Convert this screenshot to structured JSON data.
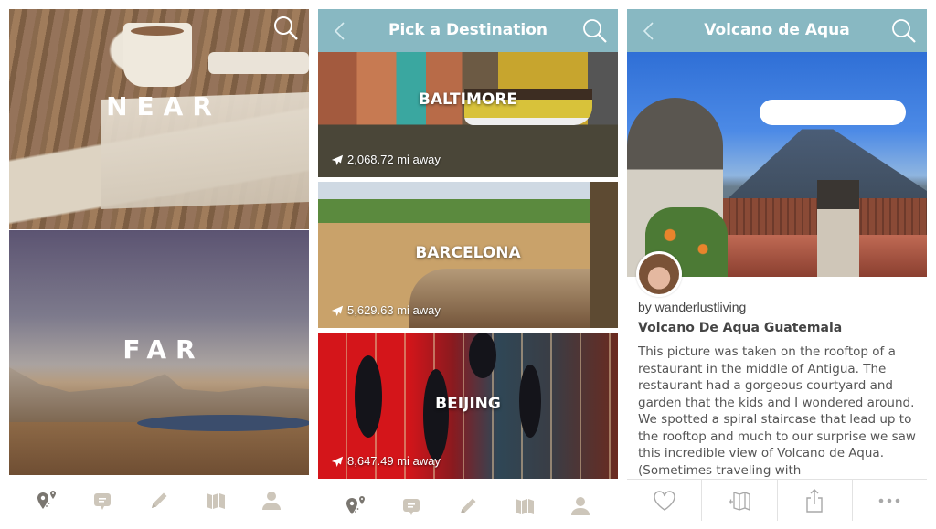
{
  "panels": {
    "near_far": {
      "near_label": "NEAR",
      "far_label": "FAR",
      "search_icon": "search-icon"
    },
    "destinations": {
      "header": {
        "title": "Pick a Destination",
        "back_icon": "chevron-left-icon",
        "search_icon": "search-icon"
      },
      "cards": [
        {
          "city": "BALTIMORE",
          "distance": "2,068.72 mi away",
          "icon": "airplane-icon"
        },
        {
          "city": "BARCELONA",
          "distance": "5,629.63 mi away",
          "icon": "airplane-icon"
        },
        {
          "city": "BEIJING",
          "distance": "8,647.49 mi away",
          "icon": "airplane-icon"
        }
      ]
    },
    "detail": {
      "header": {
        "title": "Volcano de Aqua",
        "back_icon": "chevron-left-icon",
        "search_icon": "search-icon"
      },
      "byline": "by wanderlustliving",
      "post_title": "Volcano De Aqua Guatemala",
      "post_body": "This picture was taken on the rooftop of a restaurant in the middle of Antigua. The restaurant had a gorgeous courtyard and garden that the kids and I wondered around. We spotted a spiral staircase that lead up to the rooftop and much to our surprise we saw this incredible view of Volcano de Aqua. (Sometimes traveling with",
      "actions": [
        "heart-icon",
        "add-to-map-icon",
        "share-icon",
        "more-icon"
      ]
    }
  },
  "tabbar": {
    "tabs": [
      "destinations-pin-icon",
      "chat-bubble-icon",
      "pencil-icon",
      "map-icon",
      "profile-icon"
    ],
    "active_index": 0
  },
  "colors": {
    "header_bg": "#88b8c2",
    "tab_active": "#7a7670",
    "tab_inactive": "#cdc6ba",
    "action_icon": "#a8a8a8"
  }
}
